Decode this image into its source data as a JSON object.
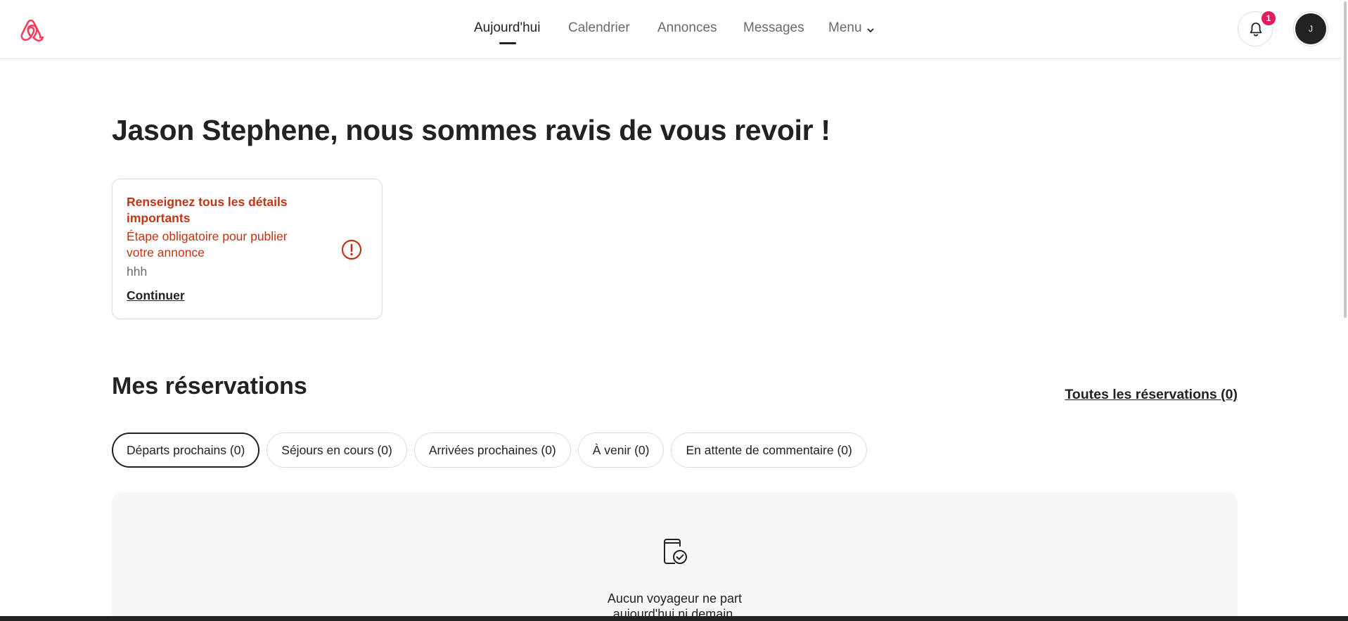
{
  "brand": {
    "accent": "#ff385c",
    "logo_icon": "airbnb-logo-icon"
  },
  "nav": {
    "items": [
      {
        "label": "Aujourd'hui",
        "active": true
      },
      {
        "label": "Calendrier",
        "active": false
      },
      {
        "label": "Annonces",
        "active": false
      },
      {
        "label": "Messages",
        "active": false
      },
      {
        "label": "Menu",
        "active": false
      }
    ]
  },
  "header": {
    "notifications_icon": "bell-icon",
    "notifications_count": "1",
    "avatar_initial": "J"
  },
  "greeting": "Jason Stephene, nous sommes ravis de vous revoir !",
  "task_card": {
    "title": "Renseignez tous les détails importants",
    "subtitle": "Étape obligatoire pour publier votre annonce",
    "listing_name": "hhh",
    "action_label": "Continuer",
    "status_color": "#c13515",
    "icon": "alert-circle-icon"
  },
  "reservations": {
    "title": "Mes réservations",
    "all_link": "Toutes les réservations (0)",
    "tabs": [
      {
        "label": "Départs prochains (0)",
        "selected": true
      },
      {
        "label": "Séjours en cours (0)",
        "selected": false
      },
      {
        "label": "Arrivées prochaines (0)",
        "selected": false
      },
      {
        "label": "À venir (0)",
        "selected": false
      },
      {
        "label": "En attente de commentaire (0)",
        "selected": false
      }
    ],
    "empty_icon": "calendar-check-icon",
    "empty_text": "Aucun voyageur ne part aujourd'hui ni demain."
  }
}
